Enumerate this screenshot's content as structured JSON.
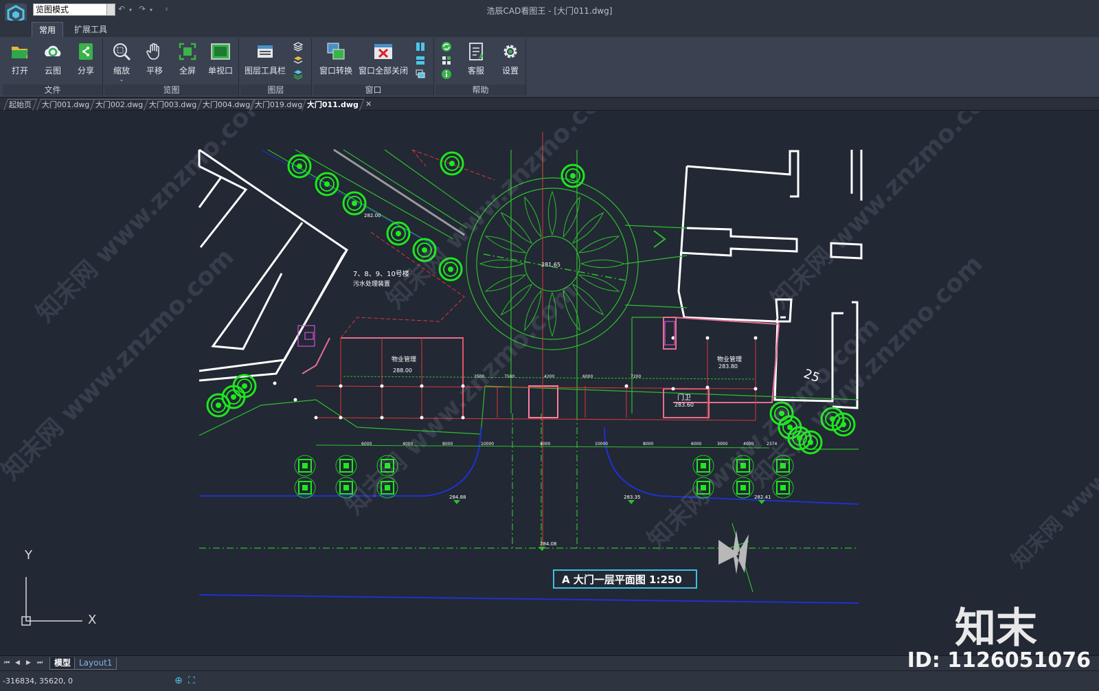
{
  "titlebar": {
    "mode_value": "览图模式",
    "window_title": "浩辰CAD看图王 - [大门011.dwg]",
    "undo_icon": "undo-arrow-icon",
    "redo_icon": "redo-arrow-icon"
  },
  "ribbon_tabs": [
    "常用",
    "扩展工具"
  ],
  "ribbon": {
    "groups": {
      "file": "文件",
      "view": "览图",
      "layer": "图层",
      "window": "窗口",
      "help": "帮助"
    },
    "buttons": {
      "open": "打开",
      "cloud": "云图",
      "share": "分享",
      "zoom": "缩放",
      "pan": "平移",
      "fullscreen": "全屏",
      "single_viewport": "单视口",
      "layer_toolbar": "图层工具栏",
      "window_switch": "窗口转换",
      "close_all": "窗口全部关闭",
      "support": "客服",
      "settings": "设置"
    }
  },
  "doc_tabs": [
    "起始页",
    "大门001.dwg",
    "大门002.dwg",
    "大门003.dwg",
    "大门004.dwg",
    "大门019.dwg",
    "大门011.dwg"
  ],
  "active_doc": "大门011.dwg",
  "drawing": {
    "title": "A 大门一层平面图   1:250",
    "label_a": "7、8、9、10号楼",
    "label_b": "污水处理装置",
    "label_c": "物业管理",
    "label_c_elev": "288.00",
    "label_d": "物业管理",
    "label_d_elev": "283.80",
    "label_e": "门卫",
    "label_e_elev": "283.60",
    "center_elev": "281.65",
    "elev_1": "282.00",
    "elev_2": "284.88",
    "elev_3": "283.35",
    "elev_4": "282.41",
    "elev_5": "284.08",
    "dim_h": [
      "6000",
      "4000",
      "8000",
      "10000",
      "4000",
      "10000",
      "8000",
      "6000",
      "3000",
      "4000",
      "2374"
    ],
    "dim_top": [
      "2500",
      "7500",
      "4200",
      "6000",
      "7200"
    ],
    "north_label": "25",
    "axis_y": "Y",
    "axis_x": "X"
  },
  "layout_tabs": [
    "模型",
    "Layout1"
  ],
  "status": {
    "coords": "-316834, 35620, 0"
  },
  "watermark": {
    "text": "知末网 www.znzmo.com",
    "brand": "知末",
    "id": "ID: 1126051076"
  },
  "colors": {
    "canvas": "#222834",
    "cad_green": "#2fbf2f",
    "cad_white": "#ffffff",
    "cad_red": "#d83a3a",
    "cad_blue": "#2030d0",
    "cad_magenta": "#d050d0",
    "tree_green": "#1ee81e"
  }
}
